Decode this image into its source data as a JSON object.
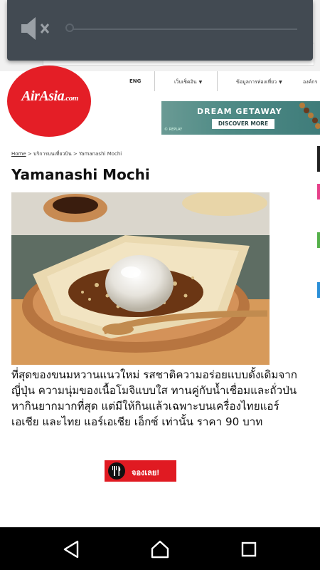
{
  "system": {
    "volume_icon": "volume-muted-icon",
    "volume_level": 0
  },
  "logo": {
    "brand": "AirAsia",
    "suffix": ".com"
  },
  "nav": {
    "lang": "ENG",
    "items": [
      "เว็บเช็คอิน",
      "ข้อมูลการท่องเที่ยว",
      "องค์กร"
    ]
  },
  "banner": {
    "title": "DREAM GETAWAY",
    "button": "DISCOVER MORE",
    "credit": "© REPLAY"
  },
  "breadcrumb": {
    "home": "Home",
    "sep1": ">",
    "section": "บริการบนเที่ยวบิน",
    "sep2": ">",
    "current": "Yamanashi Mochi"
  },
  "article": {
    "title": "Yamanashi Mochi",
    "body": "ที่สุดของขนมหวานแนวใหม่ รสชาติความอร่อยแบบดั้งเดิมจากญี่ปุ่น ความนุ่มของเนื้อโมจิแบบใส ทานคู่กับน้ำเชื่อมและถั่วป่น หากินยากมากที่สุด แต่มีให้กินแล้วเฉพาะบนเครื่องไทยแอร์เอเชีย และไทย แอร์เอเชีย เอ็กซ์ เท่านั้น ราคา 90 บาท",
    "image_alt": "yamanashi-mochi-photo"
  },
  "cta": {
    "label": "จองเลย!",
    "icon": "fork-knife-icon"
  },
  "colors": {
    "brand_red": "#e41e26",
    "button_red": "#e01a22",
    "overlay": "#424a52",
    "banner_teal": "#4f8b86"
  },
  "android_nav": {
    "back": "back-icon",
    "home": "home-icon",
    "recents": "recents-icon"
  }
}
